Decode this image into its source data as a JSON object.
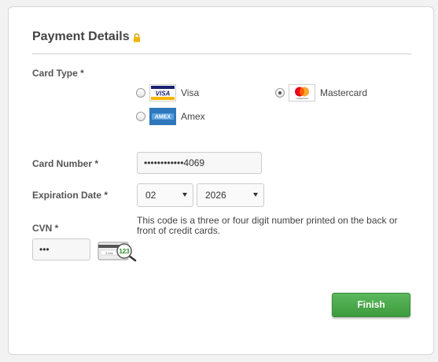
{
  "header": {
    "title": "Payment Details",
    "lock_icon": "lock-icon"
  },
  "card_type": {
    "label": "Card Type *",
    "options": [
      {
        "name": "Visa",
        "logo_text": "VISA",
        "selected": false
      },
      {
        "name": "Mastercard",
        "logo_text": "mastercard",
        "selected": true
      },
      {
        "name": "Amex",
        "logo_text": "AMEX",
        "selected": false
      }
    ]
  },
  "card_number": {
    "label": "Card Number *",
    "value": "••••••••••••4069"
  },
  "expiration": {
    "label": "Expiration Date *",
    "month": "02",
    "year": "2026"
  },
  "cvn": {
    "label": "CVN *",
    "value": "•••",
    "hint": "This code is a three or four digit number printed on the back or front of credit cards.",
    "icon_text": "123"
  },
  "actions": {
    "finish_label": "Finish"
  },
  "colors": {
    "finish_green": "#4cae4c",
    "lock_gold": "#e0a800"
  }
}
